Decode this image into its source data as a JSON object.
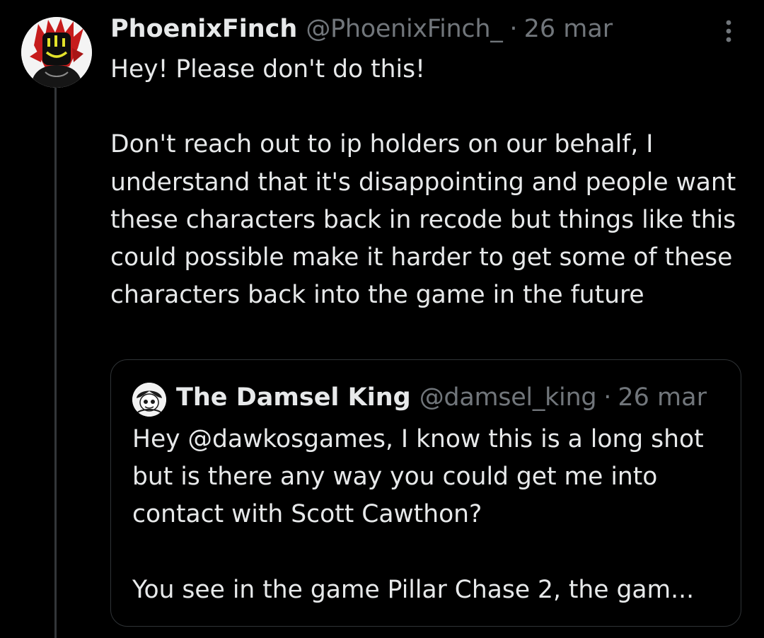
{
  "post": {
    "author": {
      "display_name": "PhoenixFinch",
      "handle": "@PhoenixFinch_",
      "avatar_icon": "avatar-icon"
    },
    "separator": "·",
    "date": "26 mar",
    "more_icon": "more-options-icon",
    "text": "Hey! Please don't do this!\n\nDon't reach out to ip holders on our behalf, I understand that it's disappointing and people want these characters back in recode but things like this could possible make it harder to get some of these characters back into the game in the future"
  },
  "quoted_post": {
    "author": {
      "display_name": "The Damsel King",
      "handle": "@damsel_king",
      "avatar_icon": "avatar-icon"
    },
    "separator": "·",
    "date": "26 mar",
    "text": "Hey @dawkosgames, I know this is a long shot but is there any way you could get me into contact with Scott Cawthon?\n\nYou see in the game Pillar Chase 2, the gam..."
  },
  "colors": {
    "background": "#000000",
    "text_primary": "#e7e9ea",
    "text_secondary": "#71767b",
    "border": "#2f3336",
    "thread_line": "#333639"
  }
}
